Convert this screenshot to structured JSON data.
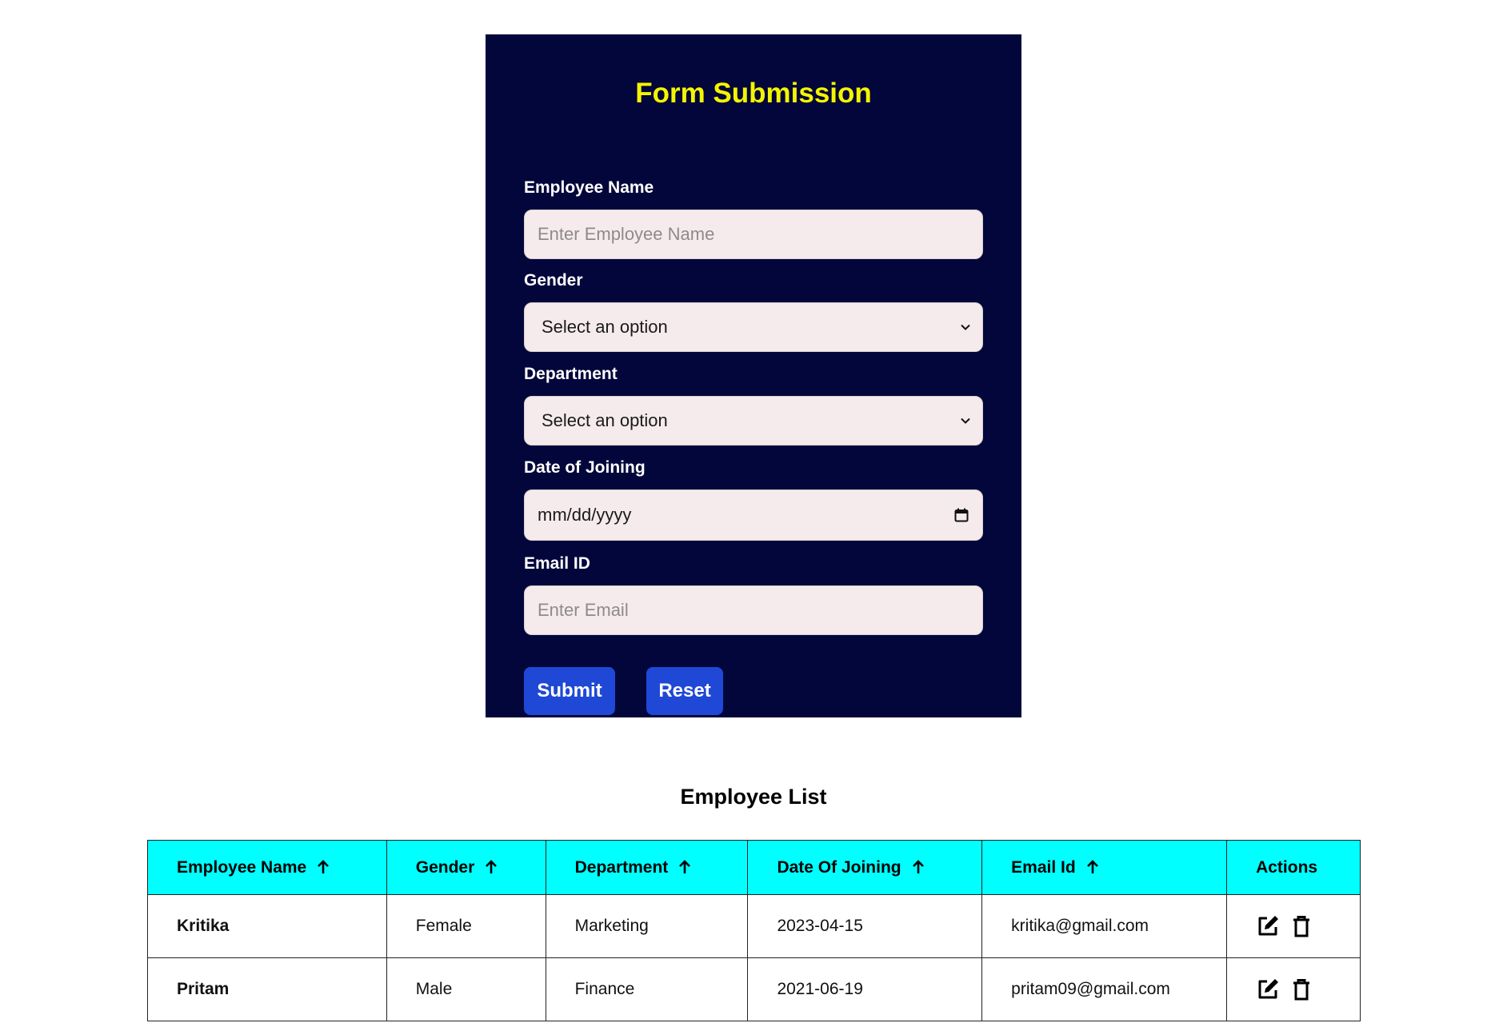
{
  "form": {
    "title": "Form Submission",
    "fields": {
      "name": {
        "label": "Employee Name",
        "placeholder": "Enter Employee Name",
        "value": ""
      },
      "gender": {
        "label": "Gender",
        "value": "Select an option"
      },
      "department": {
        "label": "Department",
        "value": "Select an option"
      },
      "doj": {
        "label": "Date of Joining",
        "value": "mm/dd/yyyy"
      },
      "email": {
        "label": "Email ID",
        "placeholder": "Enter Email",
        "value": ""
      }
    },
    "buttons": {
      "submit": "Submit",
      "reset": "Reset"
    },
    "colors": {
      "card_bg": "#02063a",
      "title": "#f4f400",
      "button": "#1f48d6",
      "field_bg": "#f6ebec"
    }
  },
  "list": {
    "title": "Employee List",
    "header_color": "#00ffff",
    "columns": [
      "Employee Name",
      "Gender",
      "Department",
      "Date Of Joining",
      "Email Id",
      "Actions"
    ],
    "sortable_icon": "arrow-up-icon",
    "rows": [
      {
        "name": "Kritika",
        "gender": "Female",
        "department": "Marketing",
        "doj": "2023-04-15",
        "email": "kritika@gmail.com"
      },
      {
        "name": "Pritam",
        "gender": "Male",
        "department": "Finance",
        "doj": "2021-06-19",
        "email": "pritam09@gmail.com"
      }
    ],
    "action_icons": [
      "edit-icon",
      "trash-icon"
    ]
  }
}
